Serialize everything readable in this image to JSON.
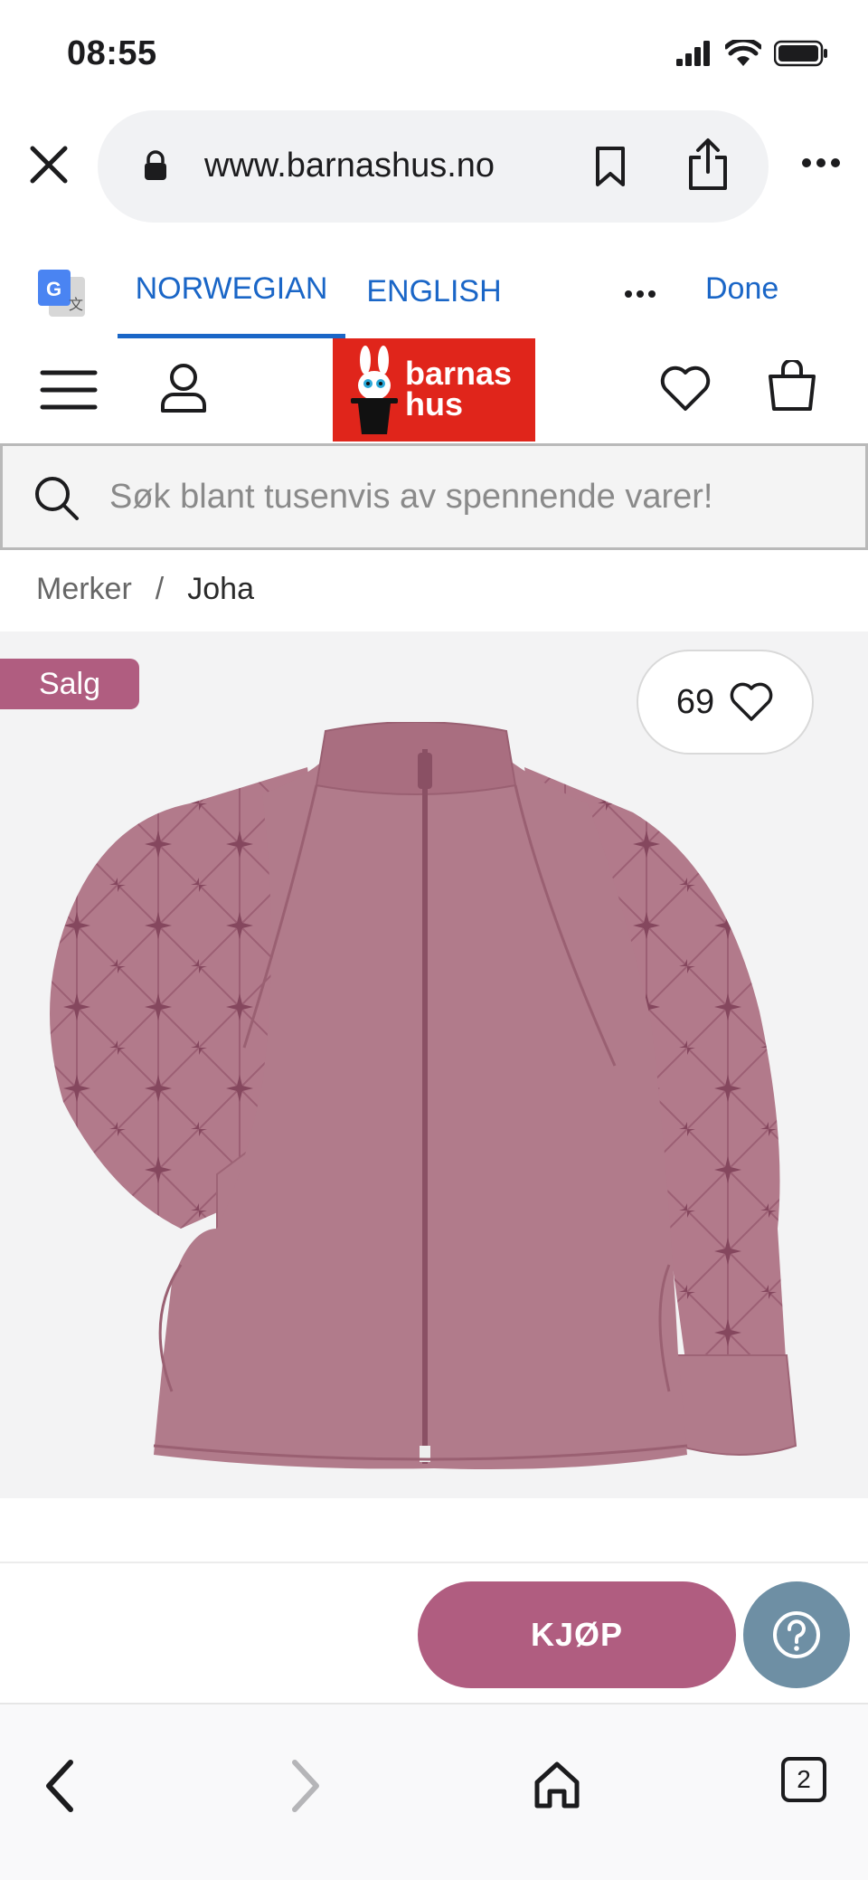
{
  "status_bar": {
    "time": "08:55"
  },
  "browser": {
    "url": "www.barnashus.no"
  },
  "translate_bar": {
    "tabs": [
      {
        "label": "NORWEGIAN",
        "active": true
      },
      {
        "label": "ENGLISH",
        "active": false
      }
    ],
    "done_label": "Done",
    "accent": "#1a66c7"
  },
  "site": {
    "logo_text_line1": "barnas",
    "logo_text_line2": "hus",
    "logo_color": "#e0251b",
    "search_placeholder": "Søk blant tusenvis av spennende varer!"
  },
  "breadcrumb": {
    "items": [
      "Merker",
      "Joha"
    ],
    "separator": "/"
  },
  "product": {
    "badge": "Salg",
    "like_count": "69",
    "accent": "#b05d80"
  },
  "actions": {
    "buy_label": "KJØP",
    "help_icon": "question-icon"
  },
  "toolbar": {
    "tab_count": "2"
  }
}
